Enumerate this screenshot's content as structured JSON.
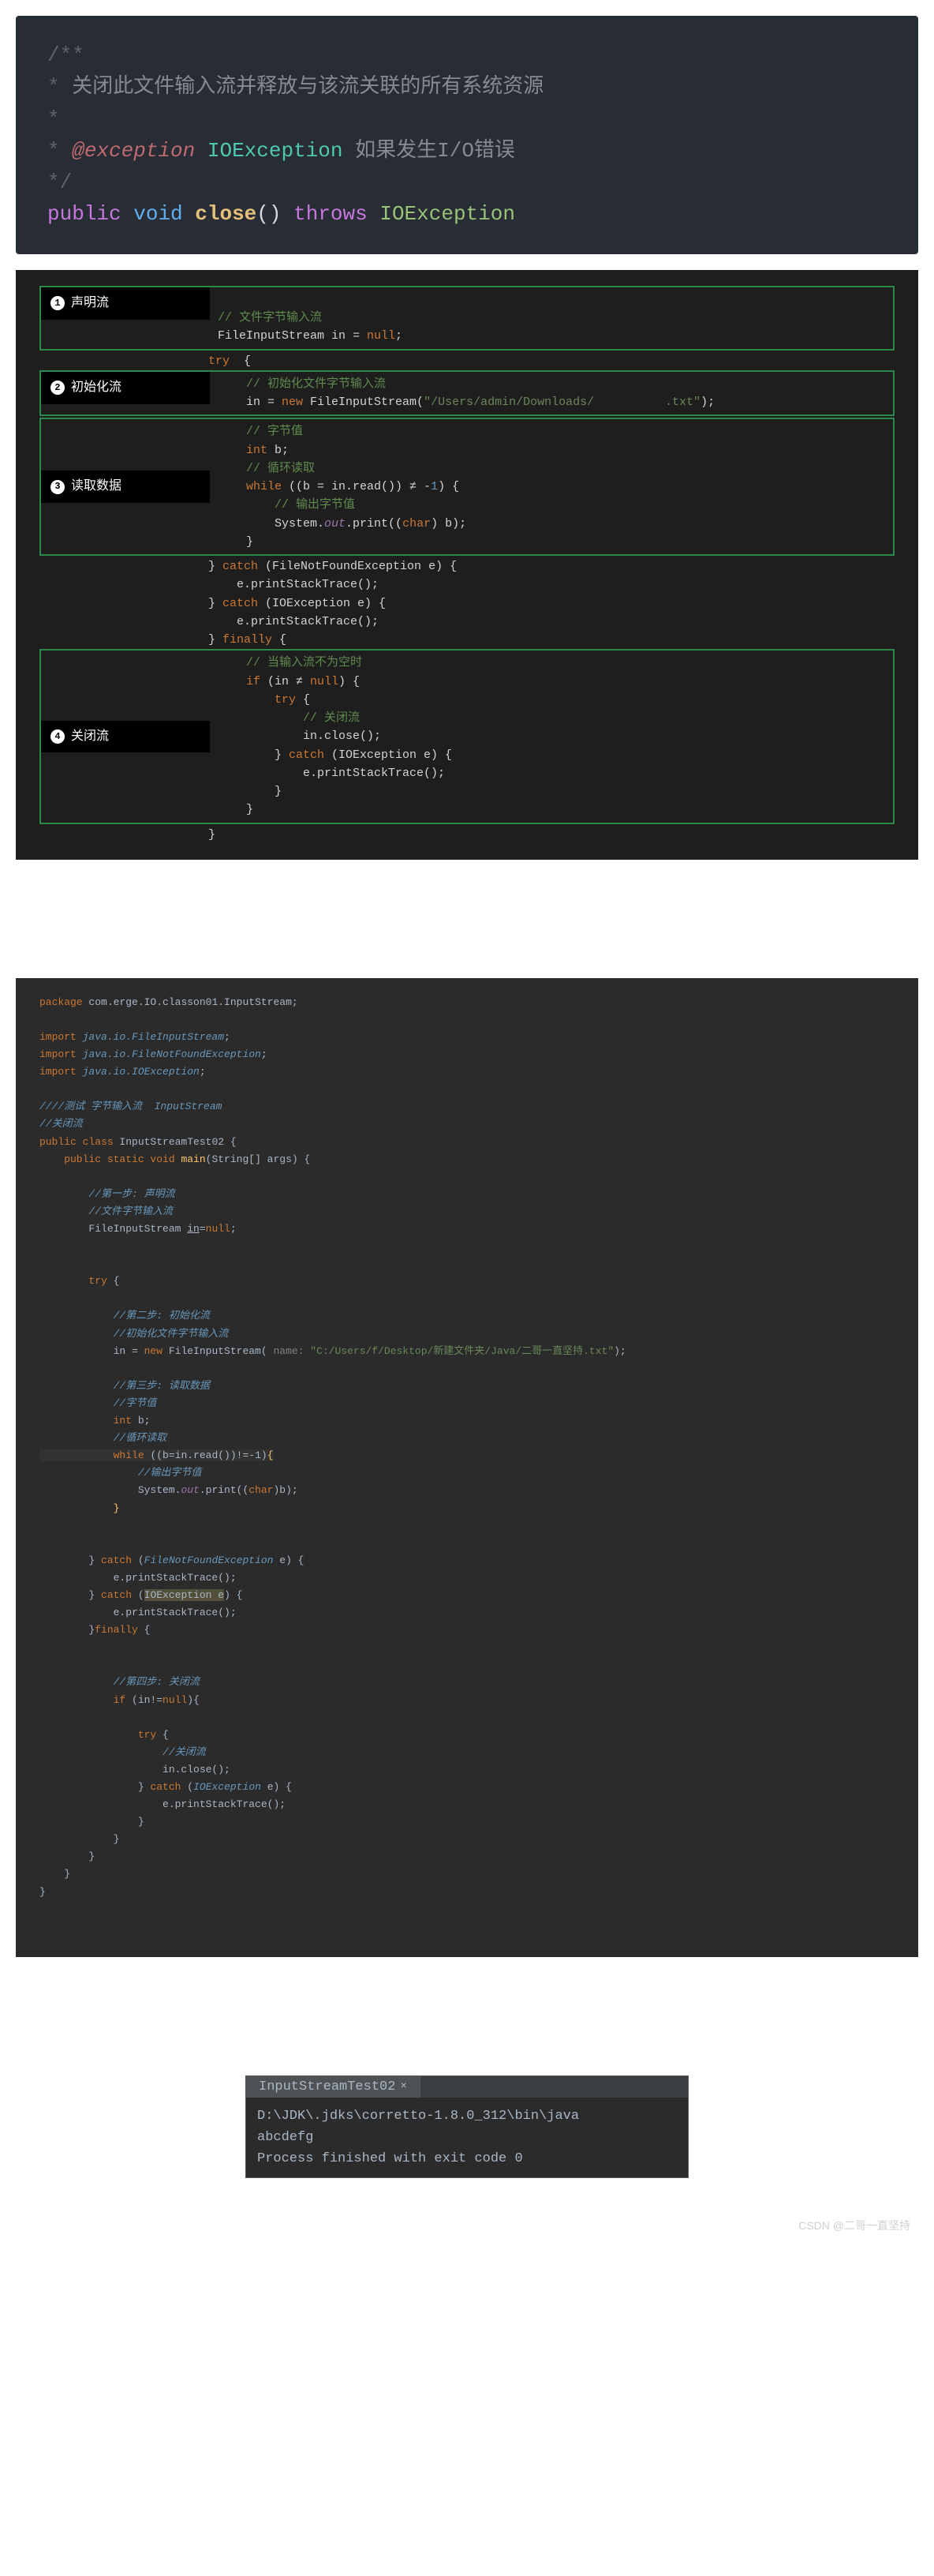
{
  "block1": {
    "line1": "/**",
    "line2_star": " * ",
    "line2_text": "关闭此文件输入流并释放与该流关联的所有系统资源",
    "line3": " *",
    "line4_star": " * ",
    "line4_tag": "@exception",
    "line4_space": "   ",
    "line4_type": "IOException",
    "line4_space2": "   ",
    "line4_desc": "如果发生I/O错误",
    "line5": " */",
    "line6_kw1": "public",
    "line6_sp1": "  ",
    "line6_kw2": "void",
    "line6_sp2": "  ",
    "line6_fn": "close",
    "line6_paren": "()",
    "line6_sp3": "  ",
    "line6_kw3": "throws",
    "line6_sp4": "  ",
    "line6_ty": "IOException"
  },
  "block2": {
    "labels": [
      "声明流",
      "初始化流",
      "读取数据",
      "关闭流"
    ],
    "nums": [
      "1",
      "2",
      "3",
      "4"
    ],
    "a1_l1": "// 文件字节输入流",
    "a1_l2a": "FileInputStream in = ",
    "a1_l2b": "null",
    "a1_l2c": ";",
    "a2_l0a": "try ",
    "a2_l0b": " {",
    "a2_l1": "    // 初始化文件字节输入流",
    "a2_l2a": "    in = ",
    "a2_l2b": "new ",
    "a2_l2c": "FileInputStream(",
    "a2_l2d": "\"/Users/admin/Downloads/          .txt\"",
    "a2_l2e": ");",
    "a3_l1": "    // 字节值",
    "a3_l2a": "    int ",
    "a3_l2b": "b;",
    "a3_l3": "    // 循环读取",
    "a3_l4a": "    while ",
    "a3_l4b": "((b = in.read()) ≠ -",
    "a3_l4c": "1",
    "a3_l4d": ") {",
    "a3_l5": "        // 输出字节值",
    "a3_l6a": "        System.",
    "a3_l6b": "out",
    "a3_l6c": ".print((",
    "a3_l6d": "char",
    "a3_l6e": ") b);",
    "a3_l7": "    }",
    "mid_l1a": "} ",
    "mid_l1b": "catch ",
    "mid_l1c": "(FileNotFoundException e) {",
    "mid_l2": "    e.printStackTrace();",
    "mid_l3a": "} ",
    "mid_l3b": "catch ",
    "mid_l3c": "(IOException e) {",
    "mid_l4": "    e.printStackTrace();",
    "mid_l5a": "} ",
    "mid_l5b": "finally ",
    "mid_l5c": "{",
    "a4_l1": "    // 当输入流不为空时",
    "a4_l2a": "    if ",
    "a4_l2b": "(in ≠ ",
    "a4_l2c": "null",
    "a4_l2d": ") {",
    "a4_l3a": "        try ",
    "a4_l3b": "{",
    "a4_l4": "            // 关闭流",
    "a4_l5": "            in.close();",
    "a4_l6a": "        } ",
    "a4_l6b": "catch ",
    "a4_l6c": "(IOException e) {",
    "a4_l7": "            e.printStackTrace();",
    "a4_l8": "        }",
    "a4_l9": "    }",
    "end": "}"
  },
  "block3": {
    "l01a": "package ",
    "l01b": "com.erge.IO.classon01.InputStream",
    "l01c": ";",
    "l02a": "import ",
    "l02b": "java.io.FileInputStream",
    "l02c": ";",
    "l03a": "import ",
    "l03b": "java.io.FileNotFoundException",
    "l03c": ";",
    "l04a": "import ",
    "l04b": "java.io.IOException",
    "l04c": ";",
    "l05": "////测试 字节输入流  InputStream",
    "l06": "//关闭流",
    "l07a": "public class ",
    "l07b": "InputStreamTest02 ",
    "l07c": "{",
    "l08a": "    public static void ",
    "l08b": "main",
    "l08c": "(String[] args) {",
    "l09": "        //第一步: 声明流",
    "l10": "        //文件字节输入流",
    "l11a": "        FileInputStream ",
    "l11b": "in",
    "l11c": "=",
    "l11d": "null",
    "l11e": ";",
    "l12a": "        try ",
    "l12b": "{",
    "l13": "            //第二步: 初始化流",
    "l14": "            //初始化文件字节输入流",
    "l15a": "            in = ",
    "l15b": "new ",
    "l15c": "FileInputStream(",
    "l15cn": " name: ",
    "l15d": "\"C:/Users/f/Desktop/新建文件夹/Java/二哥一直坚持.txt\"",
    "l15e": ");",
    "l16": "            //第三步: 读取数据",
    "l17": "            //字节值",
    "l18a": "            int ",
    "l18b": "b;",
    "l19": "            //循环读取",
    "l20a": "            while ",
    "l20b": "((b=in.read())!=-",
    "l20c": "1",
    "l20d": ")",
    "l20e": "{",
    "l21": "                //输出字节值",
    "l22a": "                System.",
    "l22b": "out",
    "l22c": ".print((",
    "l22d": "char",
    "l22e": ")b);",
    "l23": "            }",
    "l24a": "        } ",
    "l24b": "catch ",
    "l24c": "(",
    "l24d": "FileNotFoundException ",
    "l24e": "e) {",
    "l25": "            e.printStackTrace();",
    "l26a": "        } ",
    "l26b": "catch ",
    "l26c": "(",
    "l26d": "IOException e",
    "l26e": ") {",
    "l27": "            e.printStackTrace();",
    "l28a": "        }",
    "l28b": "finally ",
    "l28c": "{",
    "l29": "            //第四步: 关闭流",
    "l30a": "            if ",
    "l30b": "(in!=",
    "l30c": "null",
    "l30d": "){",
    "l31a": "                try ",
    "l31b": "{",
    "l32": "                    //关闭流",
    "l33": "                    in.close();",
    "l34a": "                } ",
    "l34b": "catch ",
    "l34c": "(",
    "l34d": "IOException ",
    "l34e": "e) {",
    "l35": "                    e.printStackTrace();",
    "l36": "                }",
    "l37": "            }",
    "l38": "        }",
    "l39": "    }",
    "l40": "}"
  },
  "block4": {
    "tab": "InputStreamTest02",
    "x": "×",
    "line1": "D:\\JDK\\.jdks\\corretto-1.8.0_312\\bin\\java",
    "line2": "abcdefg",
    "line3": "Process finished with exit code 0"
  },
  "watermark": "CSDN @二哥一直坚持"
}
